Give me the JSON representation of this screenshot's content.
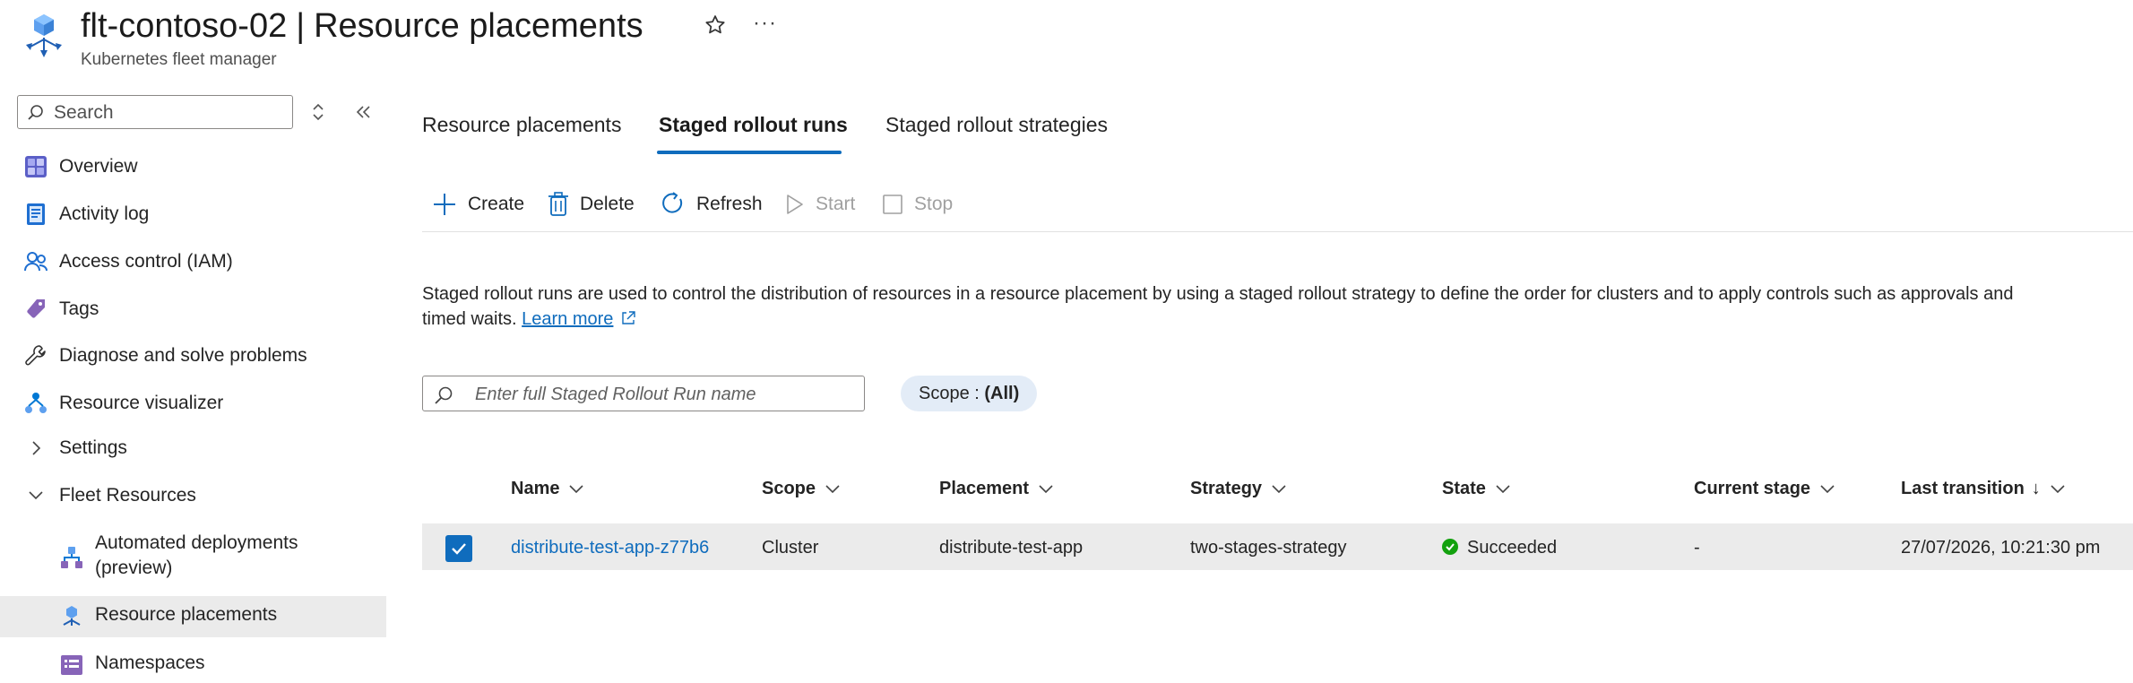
{
  "header": {
    "resource_name": "flt-contoso-02",
    "separator": "|",
    "page_name": "Resource placements",
    "subtitle": "Kubernetes fleet manager",
    "more_label": "···"
  },
  "sidebar": {
    "search_placeholder": "Search",
    "items": [
      {
        "label": "Overview",
        "icon": "overview-icon"
      },
      {
        "label": "Activity log",
        "icon": "activity-log-icon"
      },
      {
        "label": "Access control (IAM)",
        "icon": "iam-icon"
      },
      {
        "label": "Tags",
        "icon": "tag-icon"
      },
      {
        "label": "Diagnose and solve problems",
        "icon": "wrench-icon"
      },
      {
        "label": "Resource visualizer",
        "icon": "visualizer-icon"
      },
      {
        "label": "Settings",
        "icon": "chevron-right-icon"
      },
      {
        "label": "Fleet Resources",
        "icon": "chevron-down-icon"
      }
    ],
    "sub_items": [
      {
        "label_line1": "Automated deployments",
        "label_line2": "(preview)",
        "icon": "automated-deployments-icon"
      },
      {
        "label": "Resource placements",
        "icon": "resource-placements-icon",
        "selected": true
      },
      {
        "label": "Namespaces",
        "icon": "namespaces-icon"
      }
    ]
  },
  "tabs": [
    {
      "label": "Resource placements",
      "active": false
    },
    {
      "label": "Staged rollout runs",
      "active": true
    },
    {
      "label": "Staged rollout strategies",
      "active": false
    }
  ],
  "toolbar": {
    "create": "Create",
    "delete": "Delete",
    "refresh": "Refresh",
    "start": "Start",
    "stop": "Stop"
  },
  "description": {
    "text": "Staged rollout runs are used to control the distribution of resources in a resource placement by using a staged rollout strategy to define the order for clusters and to apply controls such as approvals and timed waits.",
    "link": "Learn more"
  },
  "filter": {
    "placeholder": "Enter full Staged Rollout Run name",
    "scope_label": "Scope : ",
    "scope_value": "(All)"
  },
  "table": {
    "columns": [
      "Name",
      "Scope",
      "Placement",
      "Strategy",
      "State",
      "Current stage",
      "Last transition"
    ],
    "sort_indicator": "↓",
    "rows": [
      {
        "selected": true,
        "name": "distribute-test-app-z77b6",
        "scope": "Cluster",
        "placement": "distribute-test-app",
        "strategy": "two-stages-strategy",
        "state": "Succeeded",
        "current_stage": "-",
        "last_transition": "27/07/2026, 10:21:30 pm"
      }
    ]
  },
  "colors": {
    "accent": "#0f6cbd",
    "success": "#13a10e",
    "selected_row": "#ebebeb"
  }
}
